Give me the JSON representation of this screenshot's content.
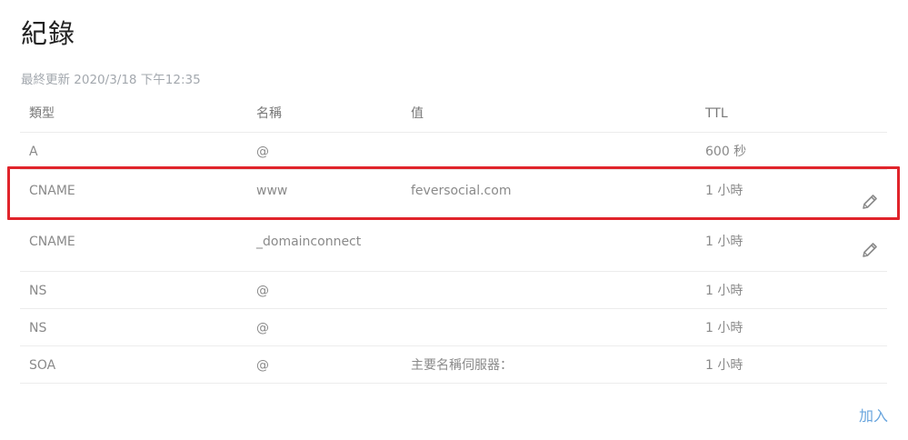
{
  "page": {
    "title": "紀錄",
    "last_updated": "最終更新 2020/3/18 下午12:35"
  },
  "table": {
    "headers": {
      "type": "類型",
      "name": "名稱",
      "value": "值",
      "ttl": "TTL"
    },
    "rows": [
      {
        "type": "A",
        "name": "@",
        "value": "",
        "ttl": "600 秒",
        "editable": false
      },
      {
        "type": "CNAME",
        "name": "www",
        "value": "feversocial.com",
        "ttl": "1 小時",
        "editable": true,
        "highlighted": true
      },
      {
        "type": "CNAME",
        "name": "_domainconnect",
        "value": "",
        "ttl": "1 小時",
        "editable": true
      },
      {
        "type": "NS",
        "name": "@",
        "value": "",
        "ttl": "1 小時",
        "editable": false
      },
      {
        "type": "NS",
        "name": "@",
        "value": "",
        "ttl": "1 小時",
        "editable": false
      },
      {
        "type": "SOA",
        "name": "@",
        "value": "主要名稱伺服器：",
        "ttl": "1 小時",
        "editable": false
      }
    ]
  },
  "actions": {
    "add_label": "加入"
  },
  "icons": {
    "edit": "pencil-icon"
  },
  "colors": {
    "highlight": "#e0242b",
    "link": "#6aa6de"
  }
}
